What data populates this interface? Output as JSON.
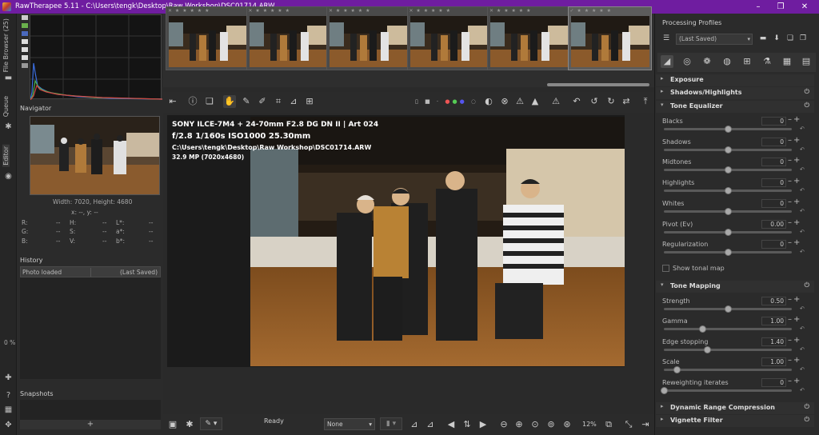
{
  "window": {
    "title": "RawTherapee 5.11 - C:\\Users\\tengk\\Desktop\\Raw Workshop\\DSC01714.ARW",
    "controls": [
      "–",
      "❐",
      "✕"
    ]
  },
  "left_tabs": {
    "file_browser": "File Browser (25)",
    "queue": "Queue",
    "editor": "Editor",
    "queue_progress": "0 %"
  },
  "navigator": {
    "title": "Navigator",
    "size": "Width: 7020, Height: 4680",
    "coords": "x: --, y: --",
    "values": {
      "r_label": "R:",
      "r_val": "--",
      "g_label": "G:",
      "g_val": "--",
      "b_label": "B:",
      "b_val": "--",
      "h_label": "H:",
      "h_val": "--",
      "s_label": "S:",
      "s_val": "--",
      "v_label": "V:",
      "v_val": "--",
      "l_label": "L*:",
      "l_val": "--",
      "a_label": "a*:",
      "a_val": "--",
      "bb_label": "b*:",
      "bb_val": "--"
    }
  },
  "history": {
    "title": "History",
    "col1": "Photo loaded",
    "col2": "(Last Saved)"
  },
  "snapshots": {
    "title": "Snapshots",
    "add": "+"
  },
  "filmstrip": {
    "thumbs": [
      {
        "stars": "✕ ★ ★ ★ ★ ★"
      },
      {
        "stars": "✕ ★ ★ ★ ★ ★"
      },
      {
        "stars": "✕ ★ ★ ★ ★ ★"
      },
      {
        "stars": "✕ ★ ★ ★ ★ ★"
      },
      {
        "stars": "✕ ★ ★ ★ ★ ★"
      },
      {
        "stars": "✓ ★ ★ ★ ★ ★"
      }
    ]
  },
  "exif": {
    "line1": "SONY ILCE-7M4 + 24-70mm F2.8 DG DN II | Art 024",
    "line2": "f/2.8  1/160s  ISO1000  25.30mm",
    "line3": "C:\\Users\\tengk\\Desktop\\Raw Workshop\\DSC01714.ARW",
    "line4": "32.9 MP (7020x4680)"
  },
  "bottombar": {
    "status": "Ready",
    "profile_select": "None",
    "zoom": "12%"
  },
  "right_panel": {
    "processing_profiles": "Processing Profiles",
    "profile_value": "(Last Saved)",
    "sections": {
      "exposure": "Exposure",
      "shadows_highlights": "Shadows/Highlights",
      "tone_equalizer": "Tone Equalizer",
      "tone_mapping": "Tone Mapping",
      "drc": "Dynamic Range Compression",
      "vignette": "Vignette Filter"
    },
    "tone_eq_sliders": [
      {
        "label": "Blacks",
        "value": "0",
        "pos": 0.5
      },
      {
        "label": "Shadows",
        "value": "0",
        "pos": 0.5
      },
      {
        "label": "Midtones",
        "value": "0",
        "pos": 0.5
      },
      {
        "label": "Highlights",
        "value": "0",
        "pos": 0.5
      },
      {
        "label": "Whites",
        "value": "0",
        "pos": 0.5
      },
      {
        "label": "Pivot (Ev)",
        "value": "0.00",
        "pos": 0.5
      },
      {
        "label": "Regularization",
        "value": "0",
        "pos": 0.5
      }
    ],
    "show_tonal_map": "Show tonal map",
    "tone_map_sliders": [
      {
        "label": "Strength",
        "value": "0.50",
        "pos": 0.5
      },
      {
        "label": "Gamma",
        "value": "1.00",
        "pos": 0.3
      },
      {
        "label": "Edge stopping",
        "value": "1.40",
        "pos": 0.34
      },
      {
        "label": "Scale",
        "value": "1.00",
        "pos": 0.1
      },
      {
        "label": "Reweighting iterates",
        "value": "0",
        "pos": 0.0
      }
    ]
  }
}
